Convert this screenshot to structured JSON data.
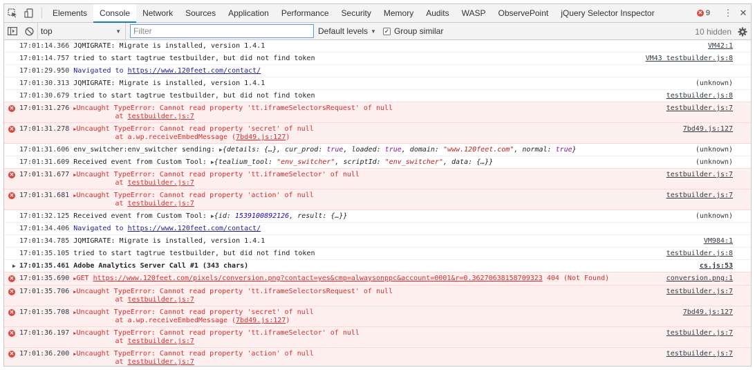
{
  "tabs": [
    "Elements",
    "Console",
    "Network",
    "Sources",
    "Application",
    "Performance",
    "Security",
    "Memory",
    "Audits",
    "WASP",
    "ObservePoint",
    "jQuery Selector Inspector"
  ],
  "error_count": "9",
  "toolbar": {
    "context": "top",
    "filter_placeholder": "Filter",
    "levels": "Default levels",
    "group_similar": "Group similar",
    "hidden": "10 hidden"
  },
  "messages": [
    {
      "type": "log",
      "ts": "17:01:14.366",
      "text": "JQMIGRATE: Migrate is installed, version 1.4.1",
      "src": "VM42:1"
    },
    {
      "type": "log",
      "ts": "17:01:14.757",
      "text": "tried to start tagtrue testbuilder, but did not find token",
      "src": "VM43 testbuilder.js:8"
    },
    {
      "type": "nav",
      "ts": "17:01:29.950",
      "text": "Navigated to ",
      "url": "https://www.120feet.com/contact/",
      "src": ""
    },
    {
      "type": "log",
      "ts": "17:01:30.313",
      "text": "JQMIGRATE: Migrate is installed, version 1.4.1",
      "src": "(unknown)"
    },
    {
      "type": "log",
      "ts": "17:01:30.679",
      "text": "tried to start tagtrue testbuilder, but did not find token",
      "src": "testbuilder.js:8"
    },
    {
      "type": "error",
      "ts": "17:01:31.276",
      "text": "Uncaught TypeError: Cannot read property 'tt.iframeSelectorsRequest' of null",
      "at": "at ",
      "at_link": "testbuilder.js:7",
      "src": "testbuilder.js:7"
    },
    {
      "type": "error",
      "ts": "17:01:31.278",
      "text": "Uncaught TypeError: Cannot read property 'secret' of null",
      "at": "at a.wp.receiveEmbedMessage (",
      "at_link": "7bd49.js:127",
      "at_end": ")",
      "src": "7bd49.js:127"
    },
    {
      "type": "obj1",
      "ts": "17:01:31.606",
      "text": "env_switcher:env_switcher sending: ",
      "src": "(unknown)"
    },
    {
      "type": "obj2",
      "ts": "17:01:31.609",
      "text": "Received event from Custom Tool: ",
      "src": "(unknown)"
    },
    {
      "type": "error",
      "ts": "17:01:31.677",
      "text": "Uncaught TypeError: Cannot read property 'tt.iframeSelector' of null",
      "at": "at ",
      "at_link": "testbuilder.js:7",
      "src": "testbuilder.js:7"
    },
    {
      "type": "error",
      "ts": "17:01:31.681",
      "text": "Uncaught TypeError: Cannot read property 'action' of null",
      "at": "at ",
      "at_link": "testbuilder.js:7",
      "src": "testbuilder.js:7"
    },
    {
      "type": "obj3",
      "ts": "17:01:32.125",
      "text": "Received event from Custom Tool: ",
      "src": "(unknown)"
    },
    {
      "type": "nav",
      "ts": "17:01:34.406",
      "text": "Navigated to ",
      "url": "https://www.120feet.com/contact/",
      "src": ""
    },
    {
      "type": "log",
      "ts": "17:01:34.785",
      "text": "JQMIGRATE: Migrate is installed, version 1.4.1",
      "src": "VM984:1"
    },
    {
      "type": "log",
      "ts": "17:01:35.105",
      "text": "tried to start tagtrue testbuilder, but did not find token",
      "src": "testbuilder.js:8"
    },
    {
      "type": "group",
      "ts": "17:01:35.461",
      "text": "Adobe Analytics Server Call #1 (343 chars)",
      "src": "cs.js:53"
    },
    {
      "type": "get",
      "ts": "17:01:35.690",
      "text": "GET ",
      "url": "https://www.120feet.com/pixels/conversion.png?contact=yes&cmp=alwaysonppc&account=0001&r=0.36270638158709323",
      "status": " 404 (Not Found)",
      "src": "conversion.png:1"
    },
    {
      "type": "error",
      "ts": "17:01:35.706",
      "text": "Uncaught TypeError: Cannot read property 'tt.iframeSelectorsRequest' of null",
      "at": "at ",
      "at_link": "testbuilder.js:7",
      "src": "testbuilder.js:7"
    },
    {
      "type": "error",
      "ts": "17:01:35.708",
      "text": "Uncaught TypeError: Cannot read property 'secret' of null",
      "at": "at a.wp.receiveEmbedMessage (",
      "at_link": "7bd49.js:127",
      "at_end": ")",
      "src": "7bd49.js:127"
    },
    {
      "type": "error",
      "ts": "17:01:36.197",
      "text": "Uncaught TypeError: Cannot read property 'tt.iframeSelector' of null",
      "at": "at ",
      "at_link": "testbuilder.js:7",
      "src": "testbuilder.js:7"
    },
    {
      "type": "error",
      "ts": "17:01:36.200",
      "text": "Uncaught TypeError: Cannot read property 'action' of null",
      "at": "at ",
      "at_link": "testbuilder.js:7",
      "src": "testbuilder.js:7"
    }
  ],
  "obj1": {
    "details": "details: ",
    "details_v": "{…}",
    "cur_prod": ", cur_prod: ",
    "cur_prod_v": "true",
    "loaded": ", loaded: ",
    "loaded_v": "true",
    "domain": ", domain: ",
    "domain_v": "\"www.120feet.com\"",
    "normal": ", normal: ",
    "normal_v": "true"
  },
  "obj2": {
    "tool": "tealium_tool: ",
    "tool_v": "\"env_switcher\"",
    "script": ", scriptId: ",
    "script_v": "\"env_switcher\"",
    "data": ", data: ",
    "data_v": "{…}"
  },
  "obj3": {
    "id": "id: ",
    "id_v": "1539100892126",
    "result": ", result: ",
    "result_v": "{…}"
  },
  "icons": {
    "inspect": "inspect-element-icon",
    "device": "device-toolbar-icon",
    "sidebar": "show-sidebar-icon",
    "clear": "clear-console-icon",
    "gear": "settings-gear-icon",
    "kebab": "more-vertical-icon",
    "close": "close-icon",
    "error": "error-circle-icon"
  },
  "prompt": "›",
  "colors": {
    "error_bg": "#fff0f0",
    "error_text": "#e02a2a",
    "link_blue": "#1a1aa6",
    "active_tab": "#1a73e8"
  }
}
